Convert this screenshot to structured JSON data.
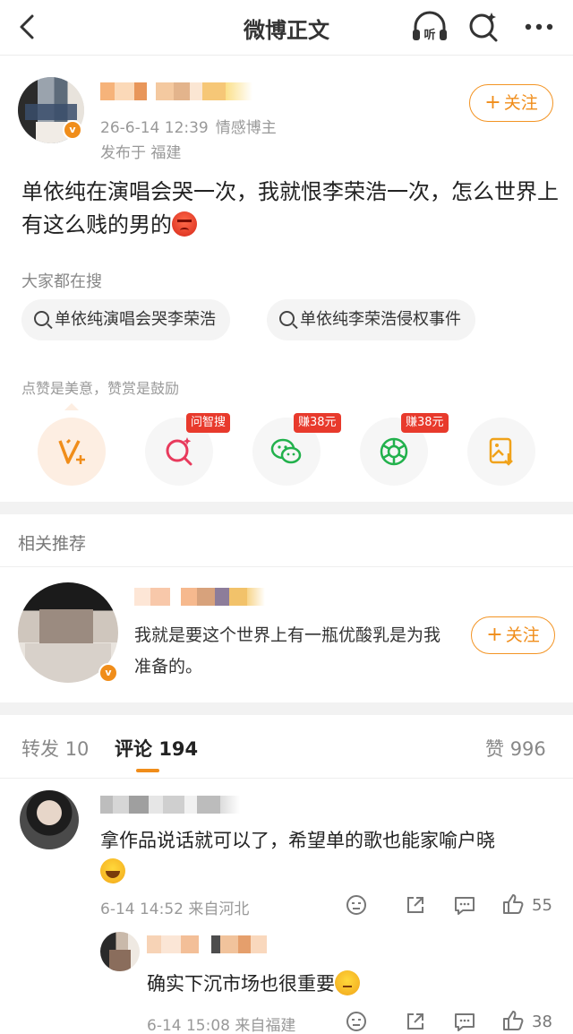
{
  "nav": {
    "title": "微博正文",
    "listen_label": "听"
  },
  "post": {
    "time": "26-6-14 12:39",
    "role": "情感博主",
    "location": "发布于 福建",
    "follow_label": "关注",
    "text": "单依纯在演唱会哭一次，我就恨李荣浩一次，怎么世界上有这么贱的男的"
  },
  "hot_search": {
    "label": "大家都在搜",
    "items": [
      "单依纯演唱会哭李荣浩",
      "单依纯李荣浩侵权事件"
    ]
  },
  "reward": {
    "label": "点赞是美意，赞赏是鼓励",
    "actions": [
      {
        "icon": "vplus-icon",
        "tag": ""
      },
      {
        "icon": "smart-search-icon",
        "tag": "问智搜"
      },
      {
        "icon": "wechat-icon",
        "tag": "赚38元"
      },
      {
        "icon": "moments-icon",
        "tag": "赚38元"
      },
      {
        "icon": "save-image-icon",
        "tag": ""
      }
    ]
  },
  "related": {
    "title": "相关推荐",
    "text": "我就是要这个世界上有一瓶优酸乳是为我准备的。",
    "follow_label": "关注"
  },
  "tabs": {
    "repost_label": "转发",
    "repost_count": "10",
    "comment_label": "评论",
    "comment_count": "194",
    "like_label": "赞",
    "like_count": "996"
  },
  "comments": [
    {
      "text": "拿作品说话就可以了，希望单的歌也能家喻户晓",
      "time": "6-14 14:52",
      "from": "来自河北",
      "likes": "55"
    },
    {
      "text": "确实下沉市场也很重要",
      "time": "6-14 15:08",
      "from": "来自福建",
      "likes": "38"
    }
  ],
  "colors": {
    "accent": "#f08d1a",
    "tag_red": "#e83a2c"
  }
}
